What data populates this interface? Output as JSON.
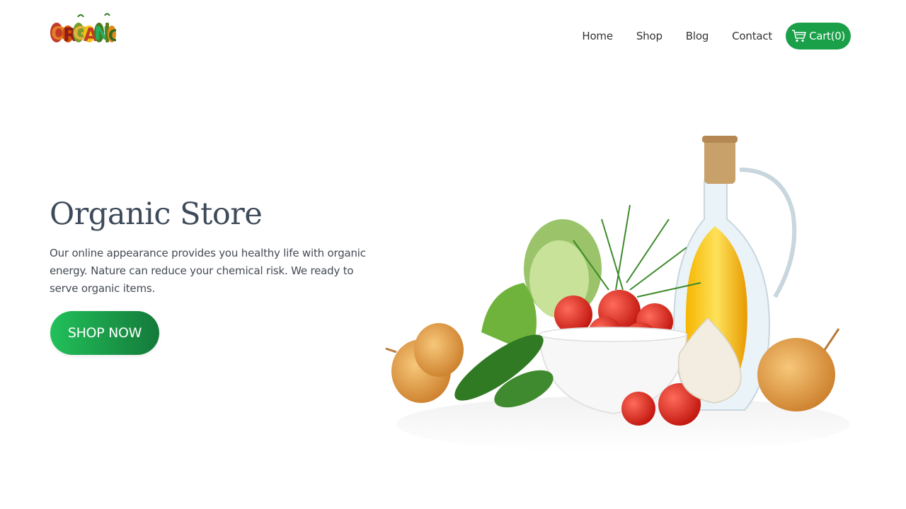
{
  "header": {
    "logo_text": "ORGANIC",
    "nav": [
      {
        "label": "Home"
      },
      {
        "label": "Shop"
      },
      {
        "label": "Blog"
      },
      {
        "label": "Contact"
      }
    ],
    "cart_label": "Cart(0)",
    "cart_icon": "cart-icon"
  },
  "hero": {
    "title": "Organic Store",
    "description": "Our online appearance provides you healthy life with organic energy. Nature can reduce your chemical risk. We ready to serve organic items.",
    "cta_label": "SHOP NOW"
  },
  "colors": {
    "accent": "#1aa049",
    "cta_start": "#22c05a",
    "cta_end": "#147a3a",
    "title": "#3e4a5a"
  }
}
